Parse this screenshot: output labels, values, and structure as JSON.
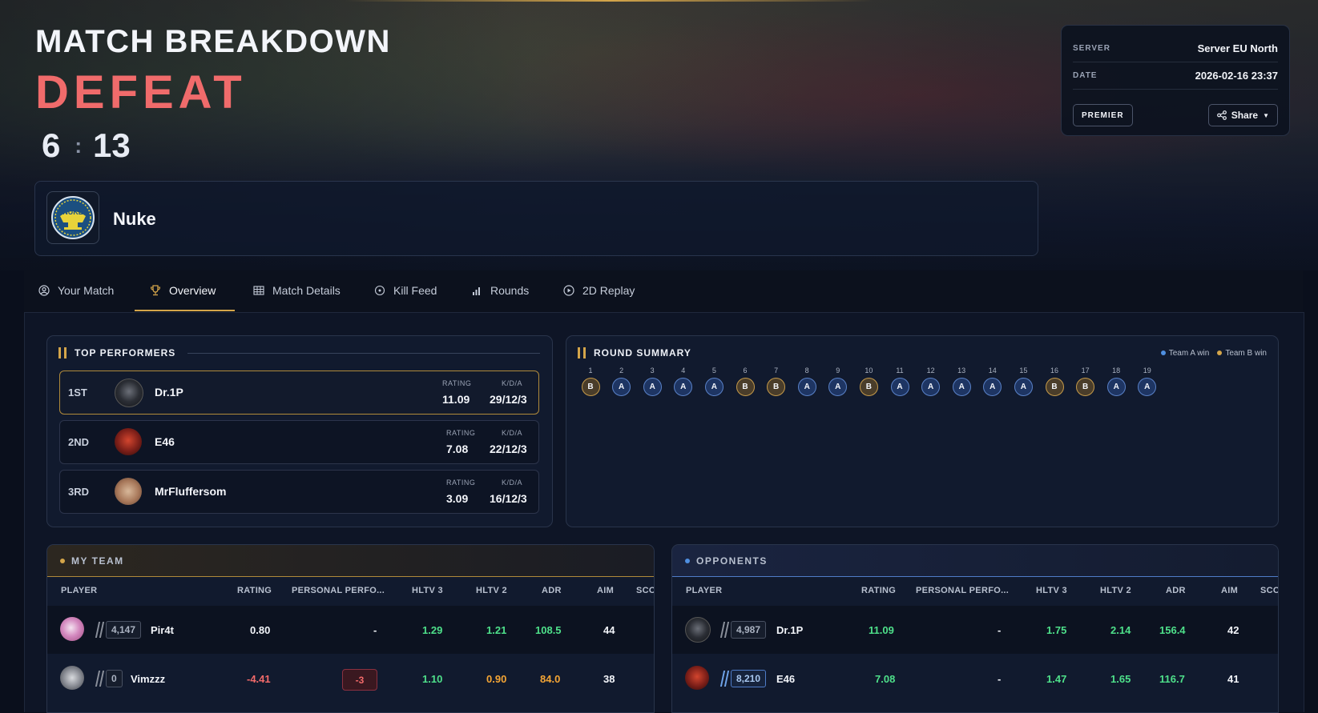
{
  "hero": {
    "title": "MATCH BREAKDOWN",
    "result": "DEFEAT",
    "score_left": "6",
    "score_sep": ":",
    "score_right": "13",
    "map_name": "Nuke",
    "map_logo_text": "NUKE"
  },
  "info": {
    "server_label": "SERVER",
    "server_value": "Server EU North",
    "date_label": "DATE",
    "date_value": "2026-02-16 23:37",
    "mode_button": "PREMIER",
    "share_button": "Share"
  },
  "tabs": [
    {
      "label": "Your Match",
      "icon": "user-circle-icon"
    },
    {
      "label": "Overview",
      "icon": "trophy-icon",
      "active": true
    },
    {
      "label": "Match Details",
      "icon": "table-icon"
    },
    {
      "label": "Kill Feed",
      "icon": "crosshair-icon"
    },
    {
      "label": "Rounds",
      "icon": "bar-chart-icon"
    },
    {
      "label": "2D Replay",
      "icon": "play-circle-icon"
    }
  ],
  "top_performers": {
    "title": "TOP PERFORMERS",
    "rating_label": "RATING",
    "kda_label": "K/D/A",
    "players": [
      {
        "rank": "1ST",
        "name": "Dr.1P",
        "rating": "11.09",
        "kda": "29/12/3"
      },
      {
        "rank": "2ND",
        "name": "E46",
        "rating": "7.08",
        "kda": "22/12/3"
      },
      {
        "rank": "3RD",
        "name": "MrFluffersom",
        "rating": "3.09",
        "kda": "16/12/3"
      }
    ]
  },
  "round_summary": {
    "title": "ROUND SUMMARY",
    "legend_a": "Team A win",
    "legend_b": "Team B win",
    "colors": {
      "team_a": "#4f8fe0",
      "team_b": "#d4a54a"
    },
    "rounds": [
      {
        "n": "1",
        "w": "B"
      },
      {
        "n": "2",
        "w": "A"
      },
      {
        "n": "3",
        "w": "A"
      },
      {
        "n": "4",
        "w": "A"
      },
      {
        "n": "5",
        "w": "A"
      },
      {
        "n": "6",
        "w": "B"
      },
      {
        "n": "7",
        "w": "B"
      },
      {
        "n": "8",
        "w": "A"
      },
      {
        "n": "9",
        "w": "A"
      },
      {
        "n": "10",
        "w": "B"
      },
      {
        "n": "11",
        "w": "A"
      },
      {
        "n": "12",
        "w": "A"
      },
      {
        "n": "13",
        "w": "A"
      },
      {
        "n": "14",
        "w": "A"
      },
      {
        "n": "15",
        "w": "A"
      },
      {
        "n": "16",
        "w": "B"
      },
      {
        "n": "17",
        "w": "B"
      },
      {
        "n": "18",
        "w": "A"
      },
      {
        "n": "19",
        "w": "A"
      }
    ]
  },
  "columns": {
    "player": "PLAYER",
    "rating": "RATING",
    "personal": "PERSONAL PERFO...",
    "hltv3": "HLTV 3",
    "hltv2": "HLTV 2",
    "adr": "ADR",
    "aim": "AIM",
    "score": "SCO"
  },
  "my_team": {
    "title": "MY TEAM",
    "players": [
      {
        "elo": "4,147",
        "name": "Pir4t",
        "rating": "0.80",
        "personal": "-",
        "hltv3": "1.29",
        "hltv2": "1.21",
        "adr": "108.5",
        "aim": "44"
      },
      {
        "elo": "0",
        "name": "Vimzzz",
        "rating": "-4.41",
        "personal": "-3",
        "hltv3": "1.10",
        "hltv2": "0.90",
        "adr": "84.0",
        "aim": "38"
      }
    ]
  },
  "opponents": {
    "title": "OPPONENTS",
    "players": [
      {
        "elo": "4,987",
        "name": "Dr.1P",
        "rating": "11.09",
        "personal": "-",
        "hltv3": "1.75",
        "hltv2": "2.14",
        "adr": "156.4",
        "aim": "42"
      },
      {
        "elo": "8,210",
        "name": "E46",
        "rating": "7.08",
        "personal": "-",
        "hltv3": "1.47",
        "hltv2": "1.65",
        "adr": "116.7",
        "aim": "41"
      }
    ]
  }
}
